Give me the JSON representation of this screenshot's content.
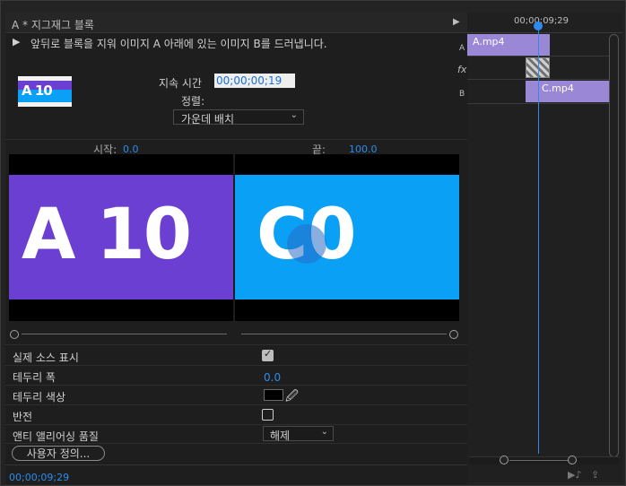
{
  "panel": {
    "title": "A * 지그재그 블록",
    "description": "앞뒤로 블록을 지워 이미지 A 아래에 있는 이미지 B를 드러냅니다."
  },
  "duration": {
    "label": "지속 시간",
    "value": "00;00;00;19"
  },
  "alignment": {
    "label": "정렬:",
    "value": "가운데 배치"
  },
  "preview": {
    "start_label": "시작:",
    "start_value": "0.0",
    "end_label": "끝:",
    "end_value": "100.0",
    "thumb_text": "A 10",
    "image_a_text": "A 10",
    "image_b_text": "C0"
  },
  "properties": {
    "show_actual": {
      "label": "실제 소스 표시",
      "checked": true
    },
    "border_width": {
      "label": "테두리 폭",
      "value": "0.0"
    },
    "border_color": {
      "label": "테두리 색상",
      "swatch": "#000000"
    },
    "reverse": {
      "label": "반전",
      "checked": false
    },
    "antialias": {
      "label": "앤티 앨리어싱 품질",
      "value": "해제"
    },
    "custom_button": "사용자 정의..."
  },
  "timecode_bottom": "00;00;09;29",
  "timeline": {
    "timecode": "00;00;09;29",
    "track_a_label": "A",
    "fx_label": "fx",
    "track_b_label": "B",
    "clip_a": "A.mp4",
    "clip_c": "C.mp4"
  },
  "colors": {
    "accent": "#2d8ceb",
    "clip": "#9a88d6",
    "image_a_bg": "#6a3fd1",
    "image_b_bg": "#0aa0f5"
  }
}
